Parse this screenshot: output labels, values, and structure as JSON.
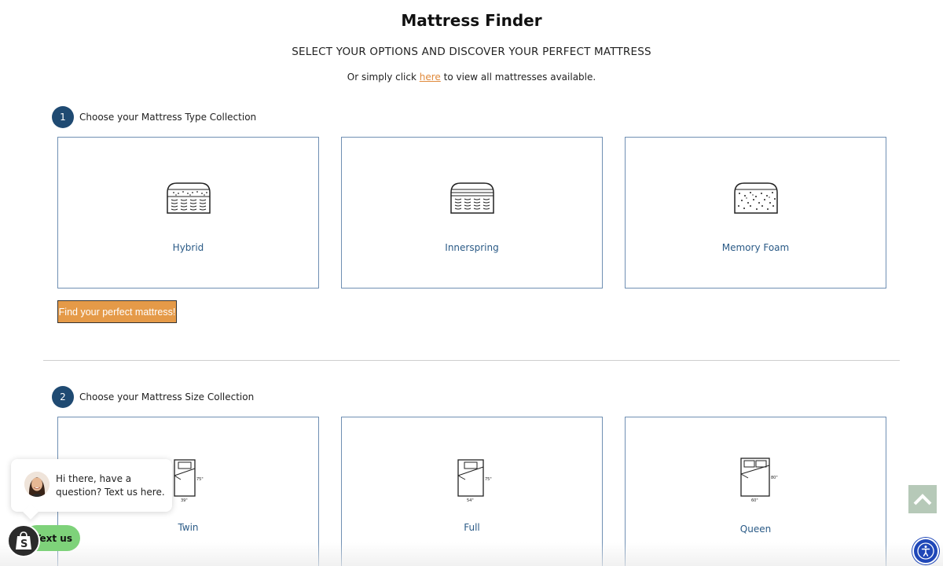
{
  "header": {
    "title": "Mattress Finder",
    "subtitle": "SELECT YOUR OPTIONS AND DISCOVER YOUR PERFECT MATTRESS",
    "intro_before": "Or simply click ",
    "intro_link": "here",
    "intro_after": " to view all mattresses available."
  },
  "step1": {
    "number": "1",
    "label": "Choose your Mattress Type Collection",
    "options": [
      {
        "label": "Hybrid",
        "icon": "hybrid-mattress-icon"
      },
      {
        "label": "Innerspring",
        "icon": "innerspring-mattress-icon"
      },
      {
        "label": "Memory Foam",
        "icon": "memory-foam-mattress-icon"
      }
    ],
    "button_label": "Find your perfect mattress!"
  },
  "step2": {
    "number": "2",
    "label": "Choose your Mattress Size Collection",
    "options": [
      {
        "label": "Twin",
        "icon": "twin-bed-icon",
        "width": "39\"",
        "length": "75\""
      },
      {
        "label": "Full",
        "icon": "full-bed-icon",
        "width": "54\"",
        "length": "75\""
      },
      {
        "label": "Queen",
        "icon": "queen-bed-icon",
        "width": "60\"",
        "length": "80\""
      }
    ]
  },
  "chat": {
    "message": "Hi there, have a question? Text us here.",
    "button_label": "Text us"
  },
  "colors": {
    "accent_orange": "#e59a48",
    "step_navy": "#1f4a72",
    "card_border": "#6f8fb3",
    "chat_green": "#7ed27a",
    "accessibility_blue": "#1f47b8"
  }
}
